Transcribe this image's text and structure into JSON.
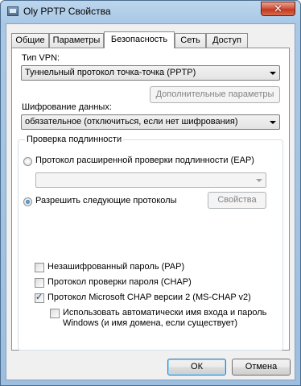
{
  "window": {
    "title": "Oly PPTP Свойства",
    "close_label": "✕"
  },
  "tabs": [
    {
      "label": "Общие",
      "active": false
    },
    {
      "label": "Параметры",
      "active": false
    },
    {
      "label": "Безопасность",
      "active": true
    },
    {
      "label": "Сеть",
      "active": false
    },
    {
      "label": "Доступ",
      "active": false
    }
  ],
  "security": {
    "vpn_type_label": "Тип VPN:",
    "vpn_type_value": "Туннельный протокол точка-точка (PPTP)",
    "advanced_button": "Дополнительные параметры",
    "encryption_label": "Шифрование данных:",
    "encryption_value": "обязательное (отключиться, если нет шифрования)",
    "auth_group_title": "Проверка подлинности",
    "eap_option": "Протокол расширенной проверки подлинности (EAP)",
    "eap_combo_value": "",
    "allow_protocols_option": "Разрешить следующие протоколы",
    "properties_button": "Свойства",
    "pap_label": "Незашифрованный пароль (PAP)",
    "chap_label": "Протокол проверки пароля (CHAP)",
    "mschapv2_label": "Протокол Microsoft CHAP версии 2 (MS-CHAP v2)",
    "auto_logon_label_line1": "Использовать автоматически имя входа и пароль",
    "auto_logon_label_line2": "Windows (и имя домена, если существует)"
  },
  "state": {
    "eap_selected": false,
    "allow_protocols_selected": true,
    "pap_checked": false,
    "chap_checked": false,
    "mschapv2_checked": true,
    "auto_logon_checked": false
  },
  "footer": {
    "ok_button": "ОК",
    "cancel_button": "Отмена"
  }
}
